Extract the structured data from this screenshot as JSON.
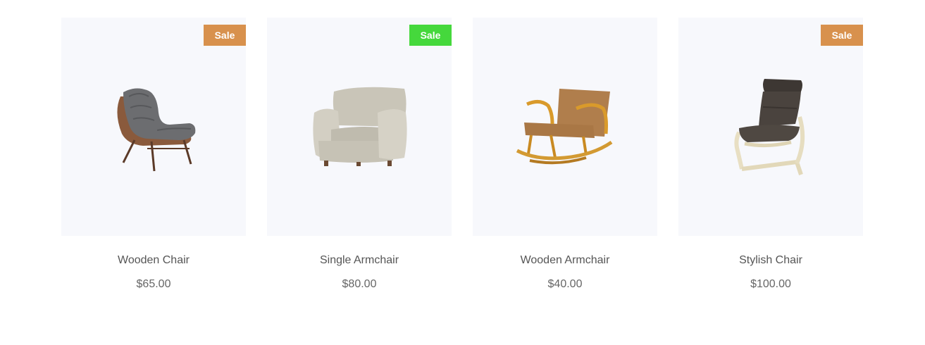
{
  "products": [
    {
      "name": "Wooden Chair",
      "price": "$65.00",
      "badge": "Sale",
      "badge_color": "#d8914d",
      "icon": "lounge-chair-icon"
    },
    {
      "name": "Single Armchair",
      "price": "$80.00",
      "badge": "Sale",
      "badge_color": "#45d83c",
      "icon": "armchair-icon"
    },
    {
      "name": "Wooden Armchair",
      "price": "$40.00",
      "badge": "",
      "icon": "rocking-chair-icon"
    },
    {
      "name": "Stylish Chair",
      "price": "$100.00",
      "badge": "Sale",
      "badge_color": "#d8914d",
      "icon": "bentwood-chair-icon"
    }
  ]
}
